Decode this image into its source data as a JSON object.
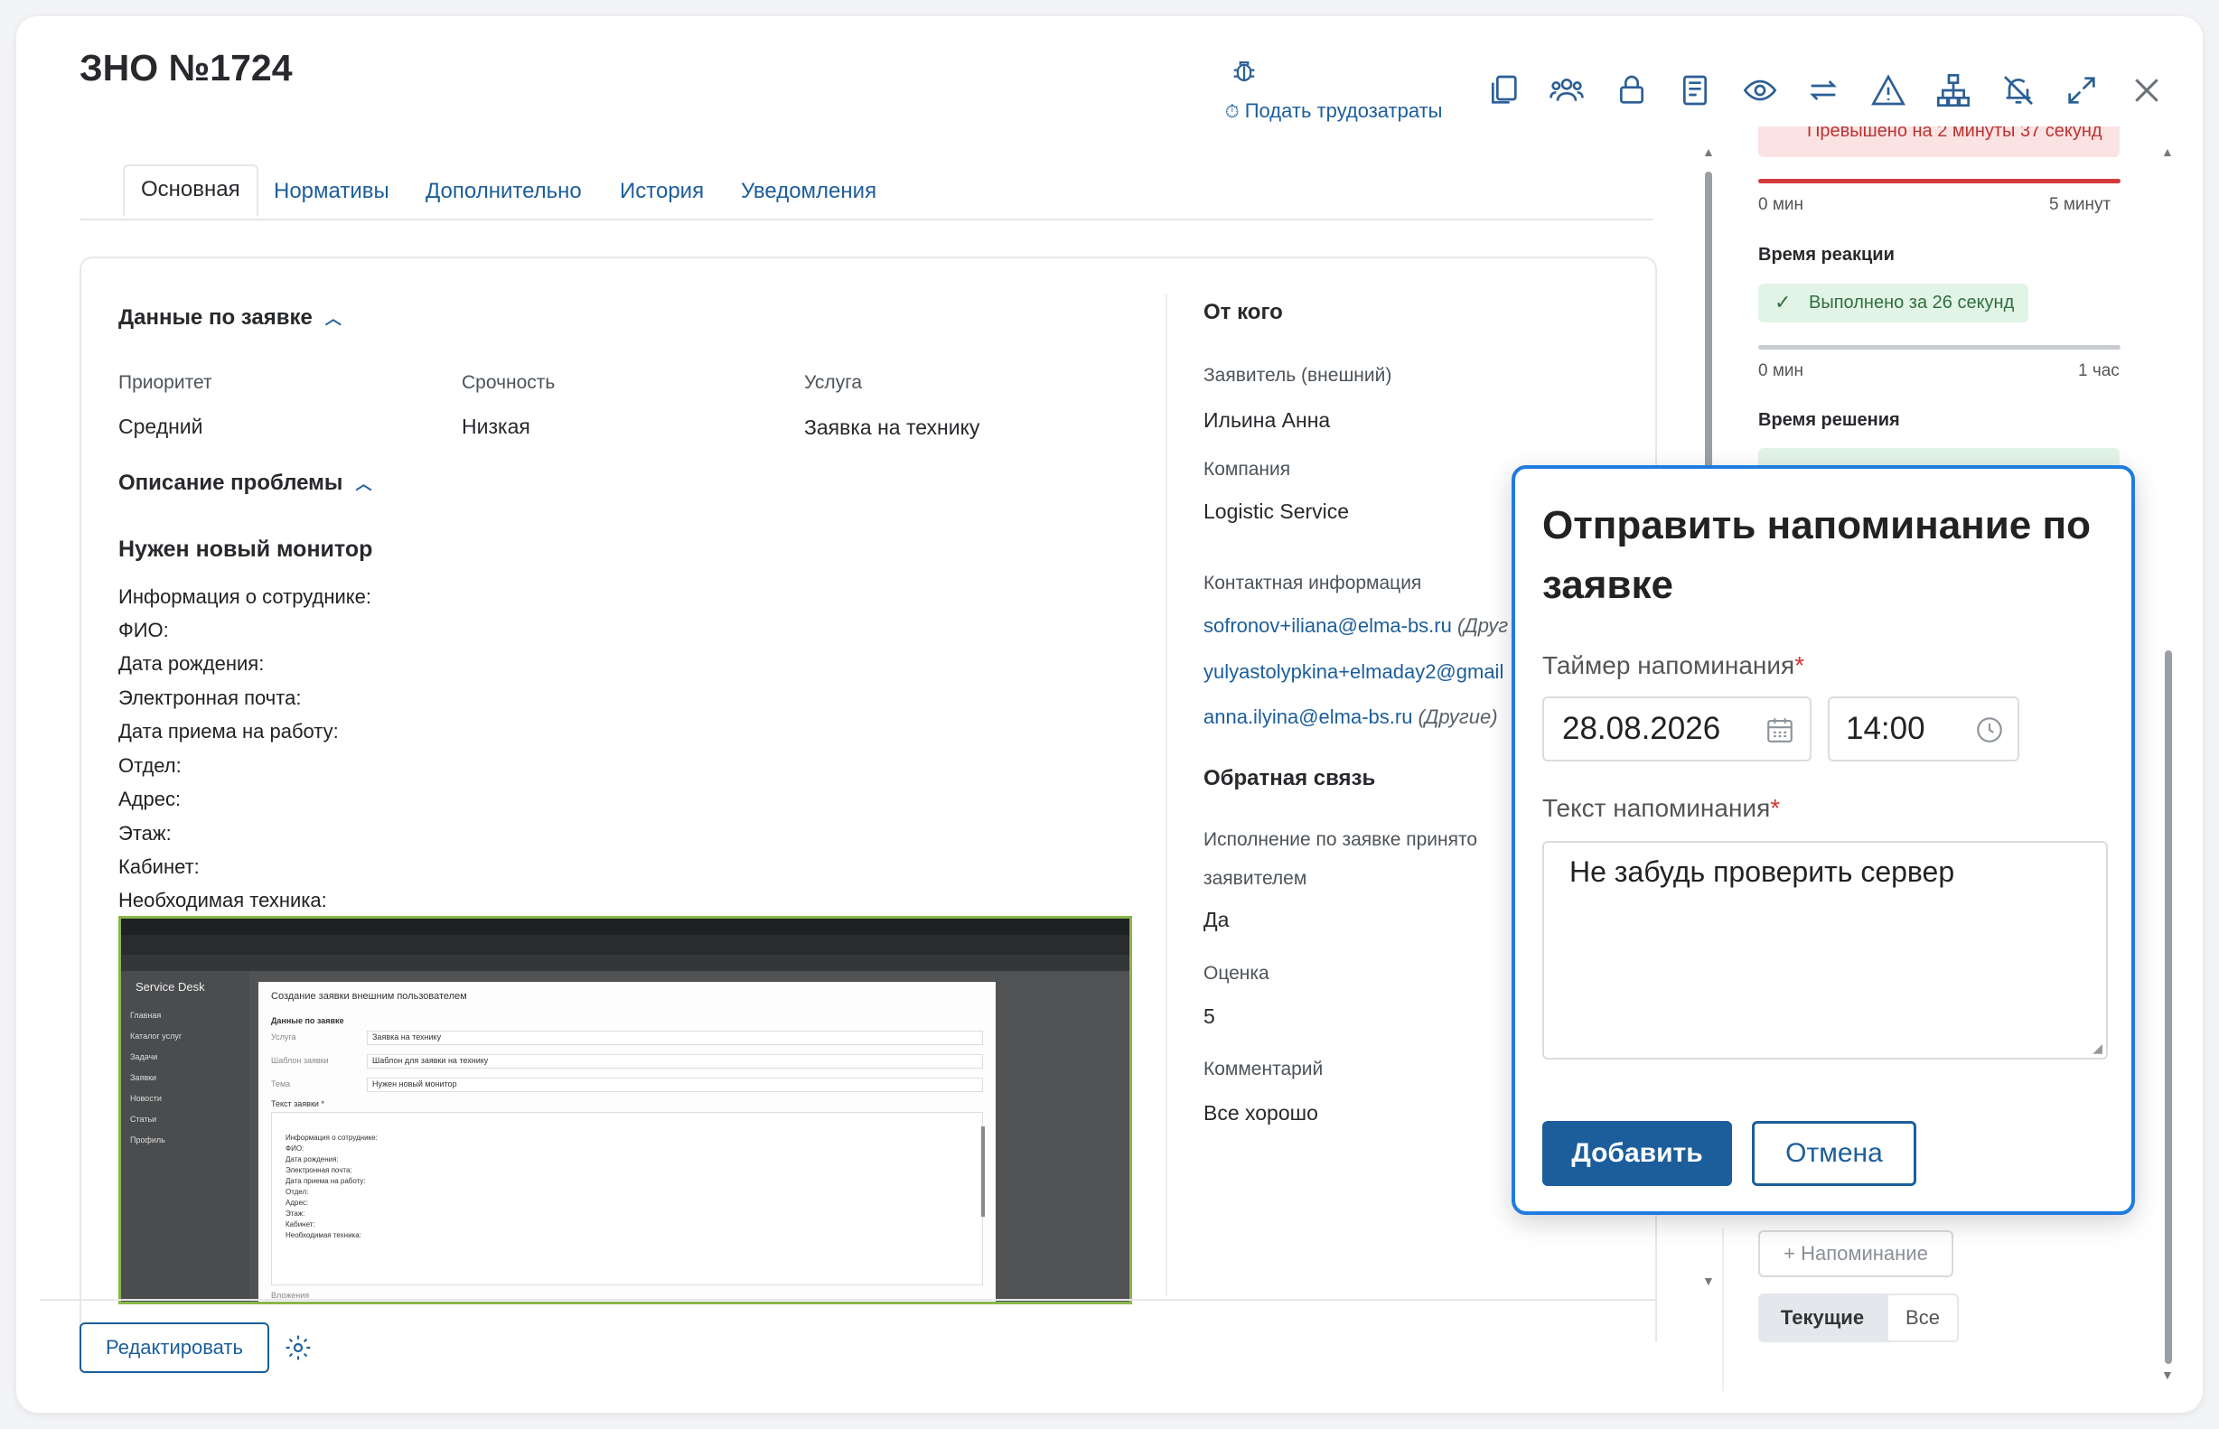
{
  "header": {
    "title": "ЗНО №1724",
    "bug_icon": "bug-icon",
    "log_time_label": "Подать трудозатраты",
    "toolbar_icons": [
      "copy-icon",
      "users-icon",
      "lock-icon",
      "book-icon",
      "eye-icon",
      "transfer-icon",
      "warning-icon",
      "hierarchy-icon",
      "bell-off-icon",
      "expand-icon",
      "close-icon"
    ]
  },
  "tabs": [
    {
      "label": "Основная",
      "active": true
    },
    {
      "label": "Нормативы"
    },
    {
      "label": "Дополнительно"
    },
    {
      "label": "История"
    },
    {
      "label": "Уведомления"
    }
  ],
  "request": {
    "section_title": "Данные по заявке",
    "priority_label": "Приоритет",
    "priority_value": "Средний",
    "urgency_label": "Срочность",
    "urgency_value": "Низкая",
    "service_label": "Услуга",
    "service_value": "Заявка на технику"
  },
  "problem": {
    "section_title": "Описание проблемы",
    "subject": "Нужен новый монитор",
    "lines": [
      "Информация о сотруднике:",
      "ФИО:",
      "Дата рождения:",
      "Электронная почта:",
      "Дата приема на работу:",
      "Отдел:",
      "Адрес:",
      "Этаж:",
      "Кабинет:",
      "Необходимая техника:"
    ]
  },
  "embedded_screenshot": {
    "app_name": "Service Desk",
    "dialog_title": "Создание заявки внешним пользователем",
    "section": "Данные по заявке",
    "sidebar_items": [
      "Главная",
      "Каталог услуг",
      "Задачи",
      "Заявки",
      "Новости",
      "Статьи",
      "Профиль"
    ],
    "fields": [
      {
        "label": "Услуга",
        "value": "Заявка на технику"
      },
      {
        "label": "Шаблон заявки",
        "value": "Шаблон для заявки на технику"
      },
      {
        "label": "Тема",
        "value": "Нужен новый монитор"
      }
    ],
    "text_label": "Текст заявки *",
    "text_lines": [
      "Информация о сотруднике:",
      "ФИО:",
      "Дата рождения:",
      "Электронная почта:",
      "Дата приема на работу:",
      "Отдел:",
      "Адрес:",
      "Этаж:",
      "Кабинет:",
      "Необходимая техника:"
    ],
    "attachments_label": "Вложения"
  },
  "from": {
    "section_title": "От кого",
    "applicant_label": "Заявитель (внешний)",
    "applicant_value": "Ильина Анна",
    "company_label": "Компания",
    "company_value": "Logistic Service",
    "contacts_label": "Контактная информация",
    "contacts": [
      {
        "value": "sofronov+iliana@elma-bs.ru",
        "tag": "(Друг"
      },
      {
        "value": "yulyastolypkina+elmaday2@gmail",
        "tag": ""
      },
      {
        "value": "anna.ilyina@elma-bs.ru",
        "tag": "(Другие)"
      }
    ]
  },
  "feedback": {
    "section_title": "Обратная связь",
    "accepted_label_1": "Исполнение по заявке принято",
    "accepted_label_2": "заявителем",
    "accepted_value": "Да",
    "rating_label": "Оценка",
    "rating_value": "5",
    "comment_label": "Комментарий",
    "comment_value": "Все хорошо"
  },
  "sla": {
    "overdue_text": "Превышено на 2 минуты 37 секунд",
    "bar1_start": "0 мин",
    "bar1_end": "5 минут",
    "reaction_title": "Время реакции",
    "reaction_status": "Выполнено за 26 секунд",
    "bar2_start": "0 мин",
    "bar2_end": "1 час",
    "solution_title": "Время решения",
    "accent_red": "#d33a3a",
    "accent_green": "#2f6e3e"
  },
  "reminders": {
    "add_label": "+ Напоминание",
    "filter_current": "Текущие",
    "filter_all": "Все"
  },
  "popup": {
    "title": "Отправить напоминание по заявке",
    "timer_label": "Таймер напоминания",
    "date_value": "28.08.2026",
    "time_value": "14:00",
    "text_label": "Текст напоминания",
    "text_value": "Не забудь проверить сервер",
    "add_button": "Добавить",
    "cancel_button": "Отмена",
    "border_color": "#1f7be0"
  },
  "footer": {
    "edit_button": "Редактировать",
    "settings_icon": "gear-icon"
  }
}
